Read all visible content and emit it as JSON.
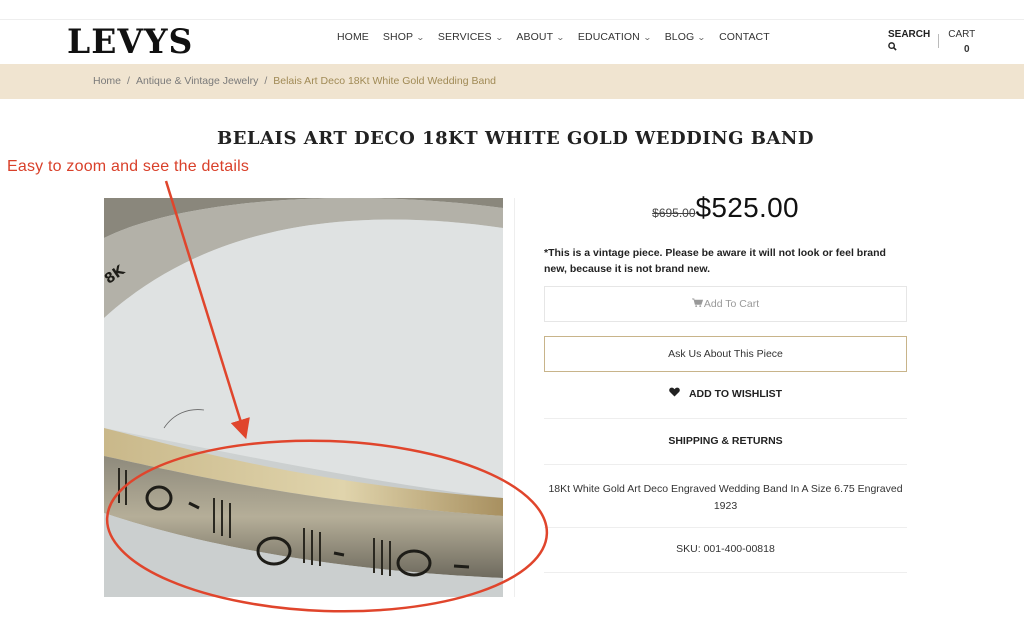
{
  "header": {
    "logo": "LEVYS",
    "nav": [
      {
        "label": "HOME",
        "has_dropdown": false
      },
      {
        "label": "SHOP",
        "has_dropdown": true
      },
      {
        "label": "SERVICES",
        "has_dropdown": true
      },
      {
        "label": "ABOUT",
        "has_dropdown": true
      },
      {
        "label": "EDUCATION",
        "has_dropdown": true
      },
      {
        "label": "BLOG",
        "has_dropdown": true
      },
      {
        "label": "CONTACT",
        "has_dropdown": false
      }
    ],
    "dropdown_glyph": "⌄",
    "search_label": "SEARCH",
    "search_icon": "search-icon",
    "cart_label": "CART",
    "cart_count": "0"
  },
  "breadcrumb": {
    "items": [
      "Home",
      "Antique & Vintage Jewelry",
      "Belais Art Deco 18Kt White Gold Wedding Band"
    ],
    "separator": "/"
  },
  "product": {
    "title": "BELAIS ART DECO 18KT WHITE GOLD WEDDING BAND",
    "old_price": "$695.00",
    "price": "$525.00",
    "vintage_note": "*This is a vintage piece. Please be aware it will not look or feel brand new, because it is not brand new.",
    "add_to_cart": "Add To Cart",
    "ask_button": "Ask Us About This Piece",
    "wishlist": "ADD TO WISHLIST",
    "shipping": "SHIPPING & RETURNS",
    "description": "18Kt White Gold Art Deco Engraved Wedding Band In A Size 6.75 Engraved 1923",
    "sku": "SKU: 001-400-00818",
    "image_alt": "Close-up of engraved white gold ring band",
    "ring_stamp": "8K"
  },
  "annotation": {
    "text": "Easy to zoom and see the details",
    "color": "#d9402a"
  },
  "colors": {
    "breadcrumb_bg": "#f0e4d0",
    "breadcrumb_current": "#a08a55",
    "ask_border": "#c8b48a"
  }
}
